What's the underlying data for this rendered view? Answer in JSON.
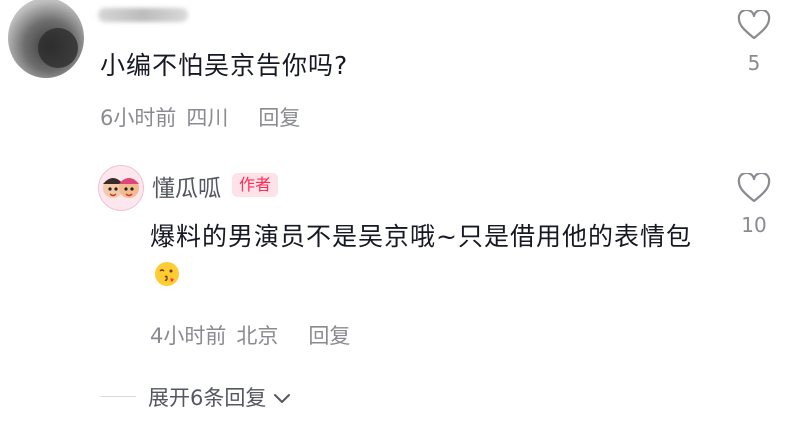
{
  "top_comment": {
    "text": "小编不怕吴京告你吗?",
    "time": "6小时前",
    "location": "四川",
    "reply_label": "回复",
    "like_count": "5"
  },
  "reply": {
    "author": "懂瓜呱",
    "badge": "作者",
    "text": "爆料的男演员不是吴京哦~只是借用他的表情包",
    "time": "4小时前",
    "location": "北京",
    "reply_label": "回复",
    "like_count": "10"
  },
  "expand_label": "展开6条回复",
  "colors": {
    "badge_text": "#fe2c55",
    "badge_bg": "#fde3e8",
    "meta_gray": "#8a8b91"
  },
  "icons": {
    "like": "heart-outline-icon",
    "expand": "chevron-down-icon",
    "emoji": "kissing-face-with-heart-emoji"
  }
}
